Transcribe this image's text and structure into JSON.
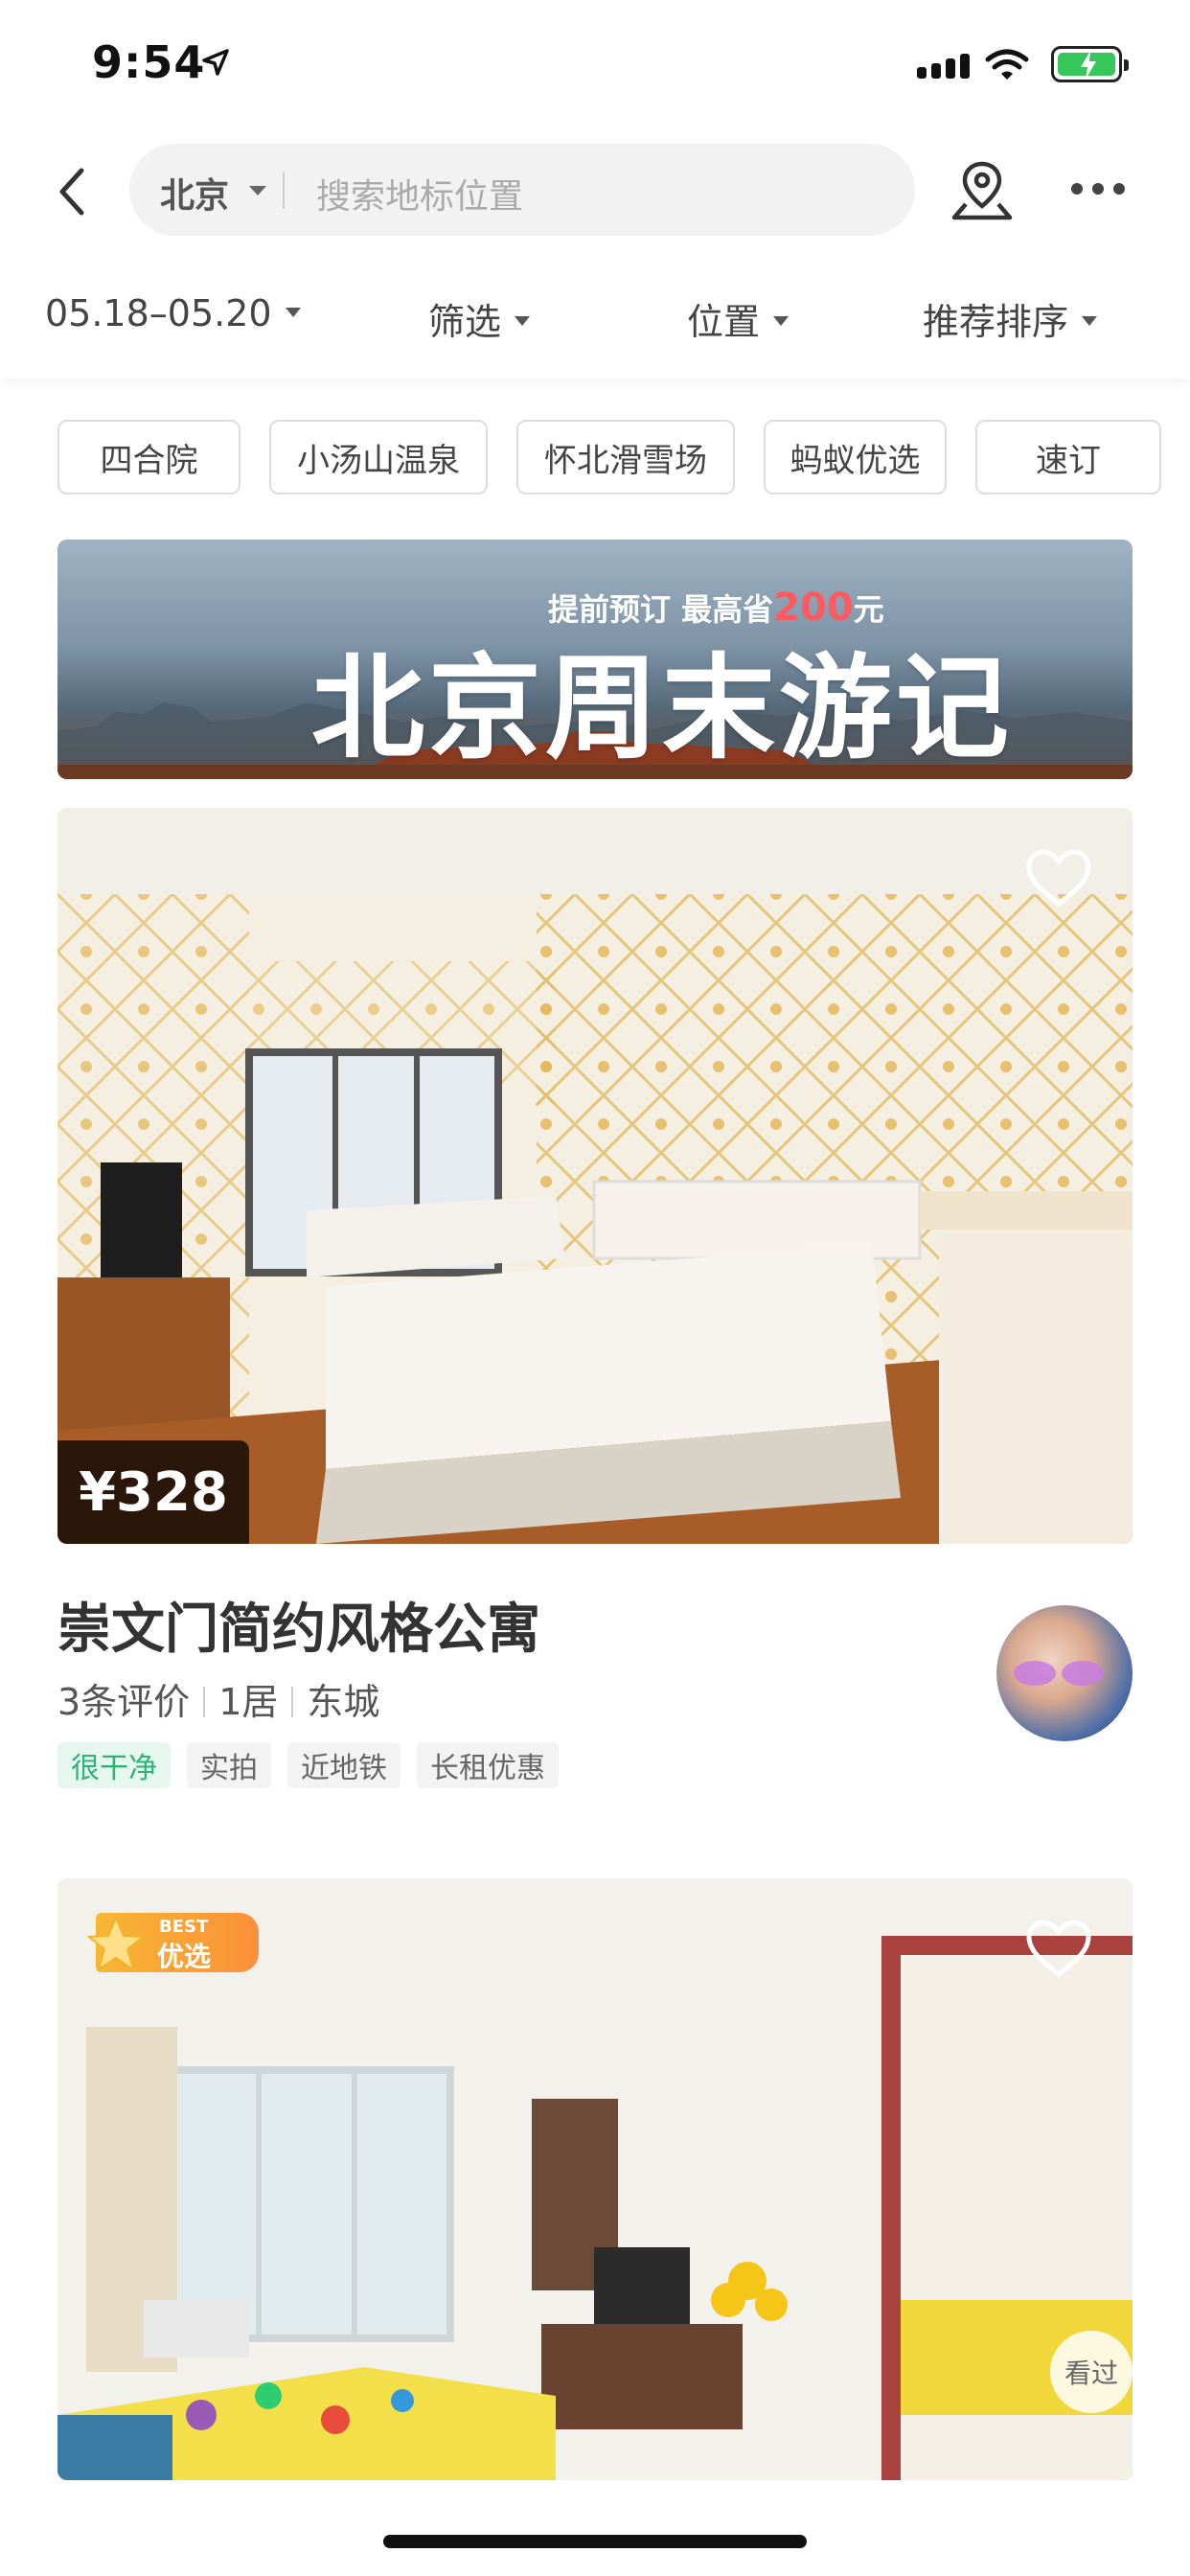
{
  "status_bar": {
    "time": "9:54"
  },
  "search": {
    "city": "北京",
    "placeholder": "搜索地标位置"
  },
  "filters": {
    "dates": "05.18–05.20",
    "filter": "筛选",
    "location": "位置",
    "sort": "推荐排序"
  },
  "chips": [
    "四合院",
    "小汤山温泉",
    "怀北滑雪场",
    "蚂蚁优选",
    "速订"
  ],
  "banner": {
    "subtitle_prefix": "提前预订 最高省",
    "subtitle_amount": "200",
    "subtitle_suffix": "元",
    "title": "北京周末游记"
  },
  "listings": [
    {
      "price": "¥328",
      "title": "崇文门简约风格公寓",
      "reviews": "3条评价",
      "rooms": "1居",
      "district": "东城",
      "tags": [
        "很干净",
        "实拍",
        "近地铁",
        "长租优惠"
      ]
    },
    {
      "badge_small": "BEST",
      "badge_big": "优选",
      "seen": "看过"
    }
  ],
  "colors": {
    "accent_green": "#2db37a",
    "banner_highlight": "#ff5a5f",
    "badge_orange": "#f7b733"
  }
}
